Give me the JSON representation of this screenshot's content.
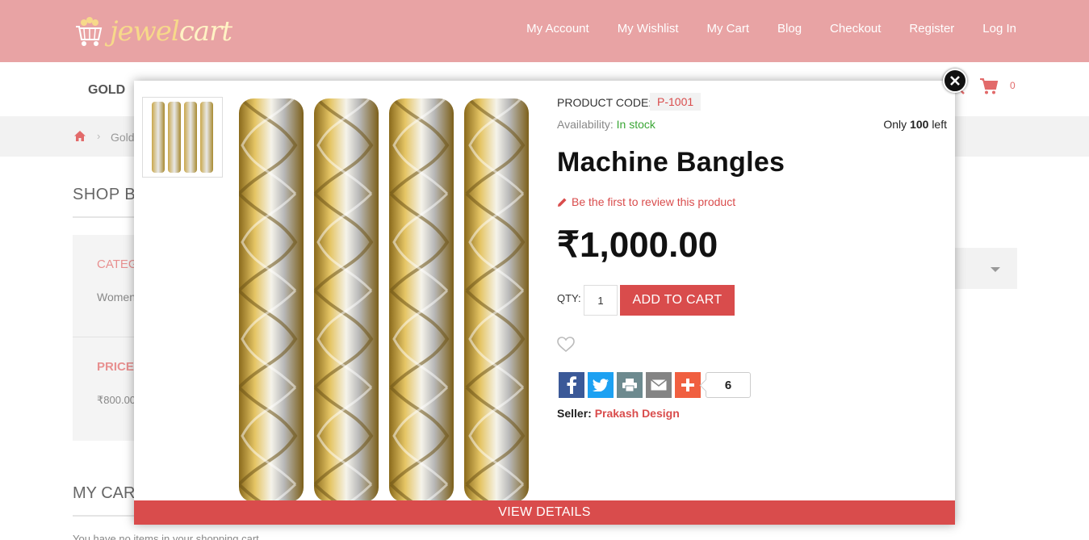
{
  "header": {
    "logo_text_a": "jewel",
    "logo_text_b": "cart",
    "nav": [
      "My Account",
      "My Wishlist",
      "My Cart",
      "Blog",
      "Checkout",
      "Register",
      "Log In"
    ],
    "bg_color": "#e8a3a4"
  },
  "mainnav": {
    "gold": "GOLD",
    "cart_count": "0"
  },
  "breadcrumb": {
    "crumb": "Gold"
  },
  "sidebar": {
    "shop_by": "SHOP BY",
    "category": "CATEG",
    "women": "Women",
    "price": "PRICE",
    "price_range": "₹800.00",
    "my_cart": "MY CAR",
    "empty_cart": "You have no items in your shopping cart."
  },
  "product": {
    "code_label": "PRODUCT CODE:",
    "code": "P-1001",
    "availability_label": "Availability:",
    "availability": "In stock",
    "only_prefix": "Only",
    "only_qty": "100",
    "only_suffix": "left",
    "title": "Machine Bangles",
    "review_link": "Be the first to review this product",
    "price": "₹1,000.00",
    "qty_label": "QTY:",
    "qty_value": "1",
    "add_to_cart": "ADD TO CART",
    "share_count": "6",
    "seller_label": "Seller:",
    "seller_name": "Prakash Design",
    "view_details": "VIEW DETAILS",
    "accent_color": "#d94c4c"
  }
}
